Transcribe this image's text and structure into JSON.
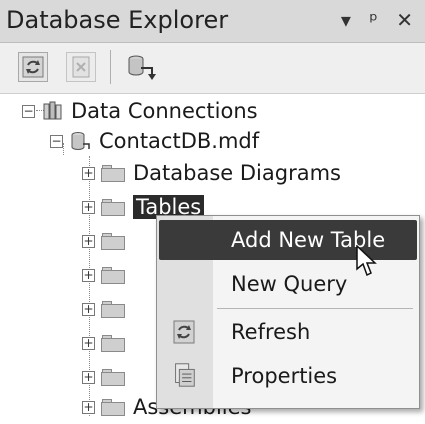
{
  "window": {
    "title": "Database Explorer",
    "controls": [
      "▾",
      "ᵖ",
      "✕"
    ]
  },
  "toolbar": {
    "buttons": [
      {
        "icon": "refresh-icon"
      },
      {
        "icon": "delete-icon"
      },
      {
        "icon": "connect-to-database-icon"
      }
    ]
  },
  "tree": {
    "root": {
      "label": "Data Connections",
      "expanded": true
    },
    "database": {
      "label": "ContactDB.mdf",
      "expanded": true
    },
    "children": [
      {
        "label": "Database Diagrams"
      },
      {
        "label": "Tables",
        "selected": true
      },
      {
        "label": ""
      },
      {
        "label": ""
      },
      {
        "label": ""
      },
      {
        "label": ""
      },
      {
        "label": ""
      },
      {
        "label": "Assemblies"
      }
    ]
  },
  "context_menu": {
    "items": [
      {
        "label": "Add New Table",
        "highlighted": true
      },
      {
        "label": "New Query"
      },
      {
        "label": "Refresh",
        "icon": "refresh-icon"
      },
      {
        "label": "Properties",
        "icon": "properties-icon"
      }
    ]
  }
}
